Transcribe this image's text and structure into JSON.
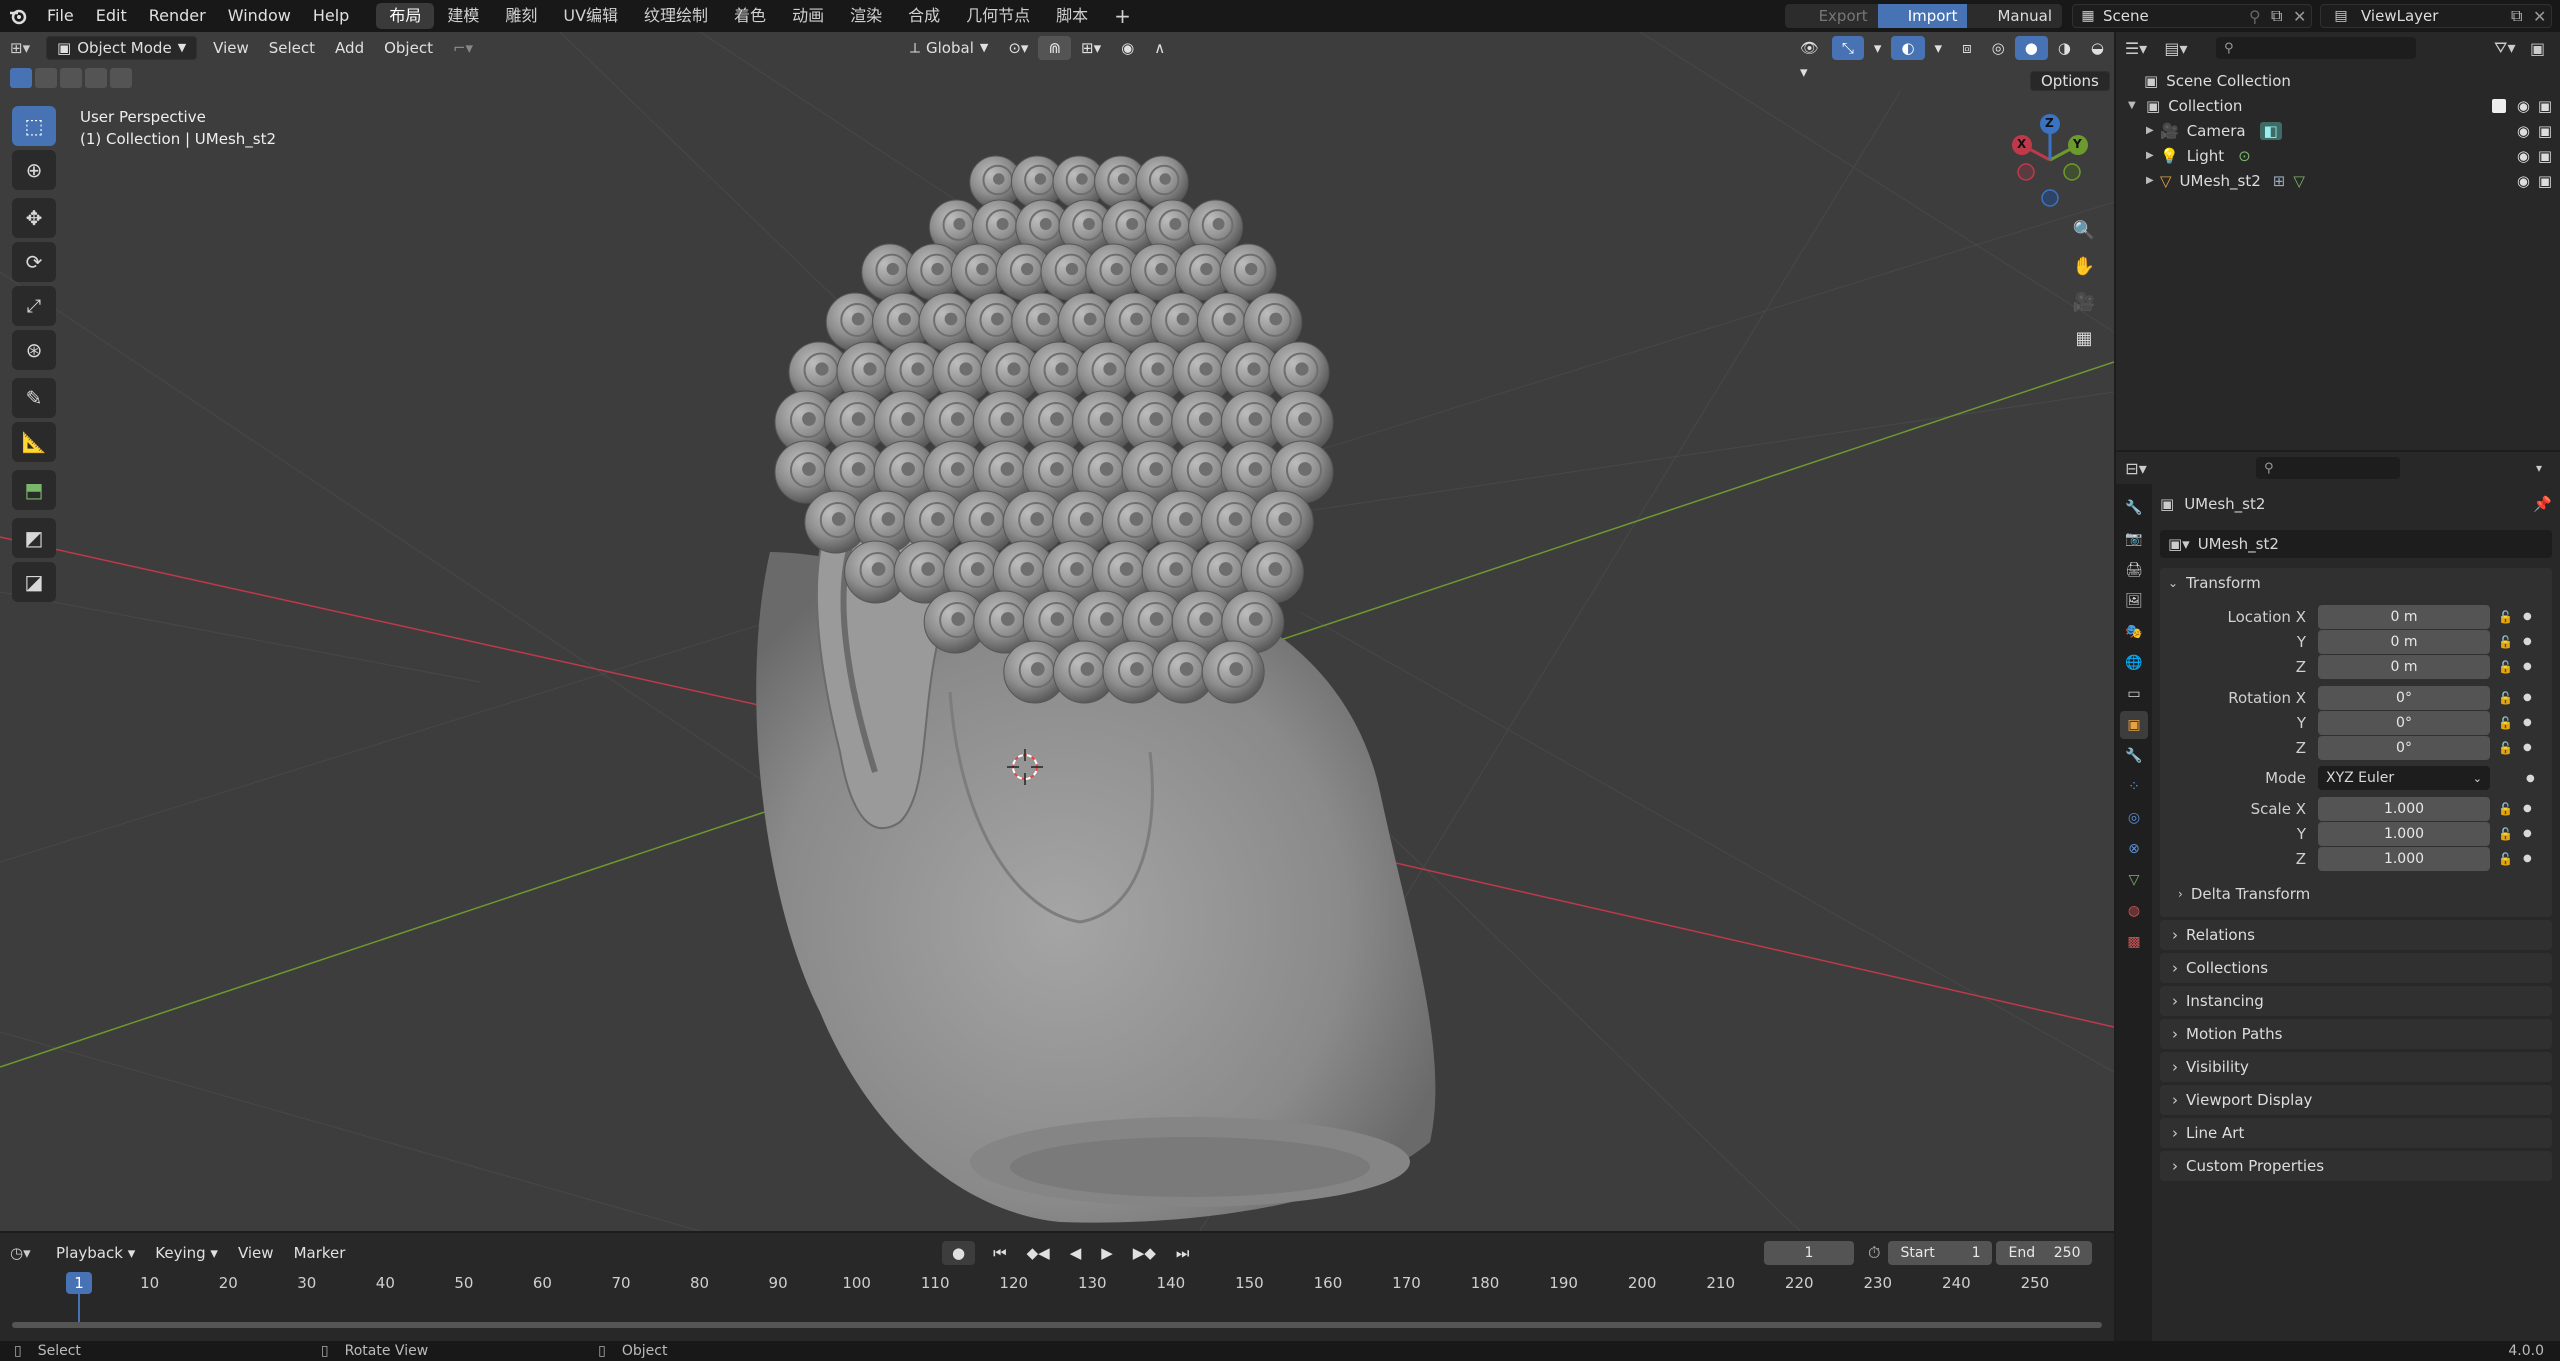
{
  "topbar": {
    "menus": [
      "File",
      "Edit",
      "Render",
      "Window",
      "Help"
    ],
    "workspaces": [
      "布局",
      "建模",
      "雕刻",
      "UV编辑",
      "纹理绘制",
      "着色",
      "动画",
      "渲染",
      "合成",
      "几何节点",
      "脚本"
    ],
    "active_workspace": "布局",
    "add_tab": "+",
    "export_label": "Export",
    "import_label": "Import",
    "manual_label": "Manual",
    "scene_name": "Scene",
    "viewlayer_name": "ViewLayer"
  },
  "viewport_header": {
    "mode": "Object Mode",
    "menus": [
      "View",
      "Select",
      "Add",
      "Object"
    ],
    "transform_orientation": "Global",
    "options_label": "Options"
  },
  "viewport": {
    "view_name": "User Perspective",
    "collection_info": "(1) Collection | UMesh_st2",
    "gizmo_axes": [
      "X",
      "Y",
      "Z"
    ],
    "x_axis_color": "#c0394b",
    "y_axis_color": "#6d9a2f",
    "accent": "#4772b3"
  },
  "toolbar": {
    "tools": [
      "select-box-icon",
      "cursor-icon",
      "move-icon",
      "rotate-icon",
      "scale-icon",
      "transform-icon",
      "annotate-icon",
      "measure-icon",
      "add-cube-icon",
      "extrude-icon",
      "knife-icon"
    ]
  },
  "outliner": {
    "root": "Scene Collection",
    "collection": "Collection",
    "items": [
      {
        "name": "Camera",
        "type": "camera"
      },
      {
        "name": "Light",
        "type": "light"
      },
      {
        "name": "UMesh_st2",
        "type": "mesh"
      }
    ]
  },
  "properties": {
    "object_name": "UMesh_st2",
    "datablock_name": "UMesh_st2",
    "transform_label": "Transform",
    "location": {
      "label_x": "Location X",
      "label_y": "Y",
      "label_z": "Z",
      "x": "0 m",
      "y": "0 m",
      "z": "0 m"
    },
    "rotation": {
      "label_x": "Rotation X",
      "label_y": "Y",
      "label_z": "Z",
      "x": "0°",
      "y": "0°",
      "z": "0°"
    },
    "mode_label": "Mode",
    "mode_value": "XYZ Euler",
    "scale": {
      "label_x": "Scale X",
      "label_y": "Y",
      "label_z": "Z",
      "x": "1.000",
      "y": "1.000",
      "z": "1.000"
    },
    "delta_transform": "Delta Transform",
    "panels": [
      "Relations",
      "Collections",
      "Instancing",
      "Motion Paths",
      "Visibility",
      "Viewport Display",
      "Line Art",
      "Custom Properties"
    ]
  },
  "timeline": {
    "menus": [
      "Playback",
      "Keying",
      "View",
      "Marker"
    ],
    "current_frame": "1",
    "start_label": "Start",
    "start_value": "1",
    "end_label": "End",
    "end_value": "250",
    "ticks": [
      "1",
      "10",
      "20",
      "30",
      "40",
      "50",
      "60",
      "70",
      "80",
      "90",
      "100",
      "110",
      "120",
      "130",
      "140",
      "150",
      "160",
      "170",
      "180",
      "190",
      "200",
      "210",
      "220",
      "230",
      "240",
      "250"
    ]
  },
  "statusbar": {
    "select": "Select",
    "rotate_view": "Rotate View",
    "object": "Object",
    "version": "4.0.0"
  }
}
